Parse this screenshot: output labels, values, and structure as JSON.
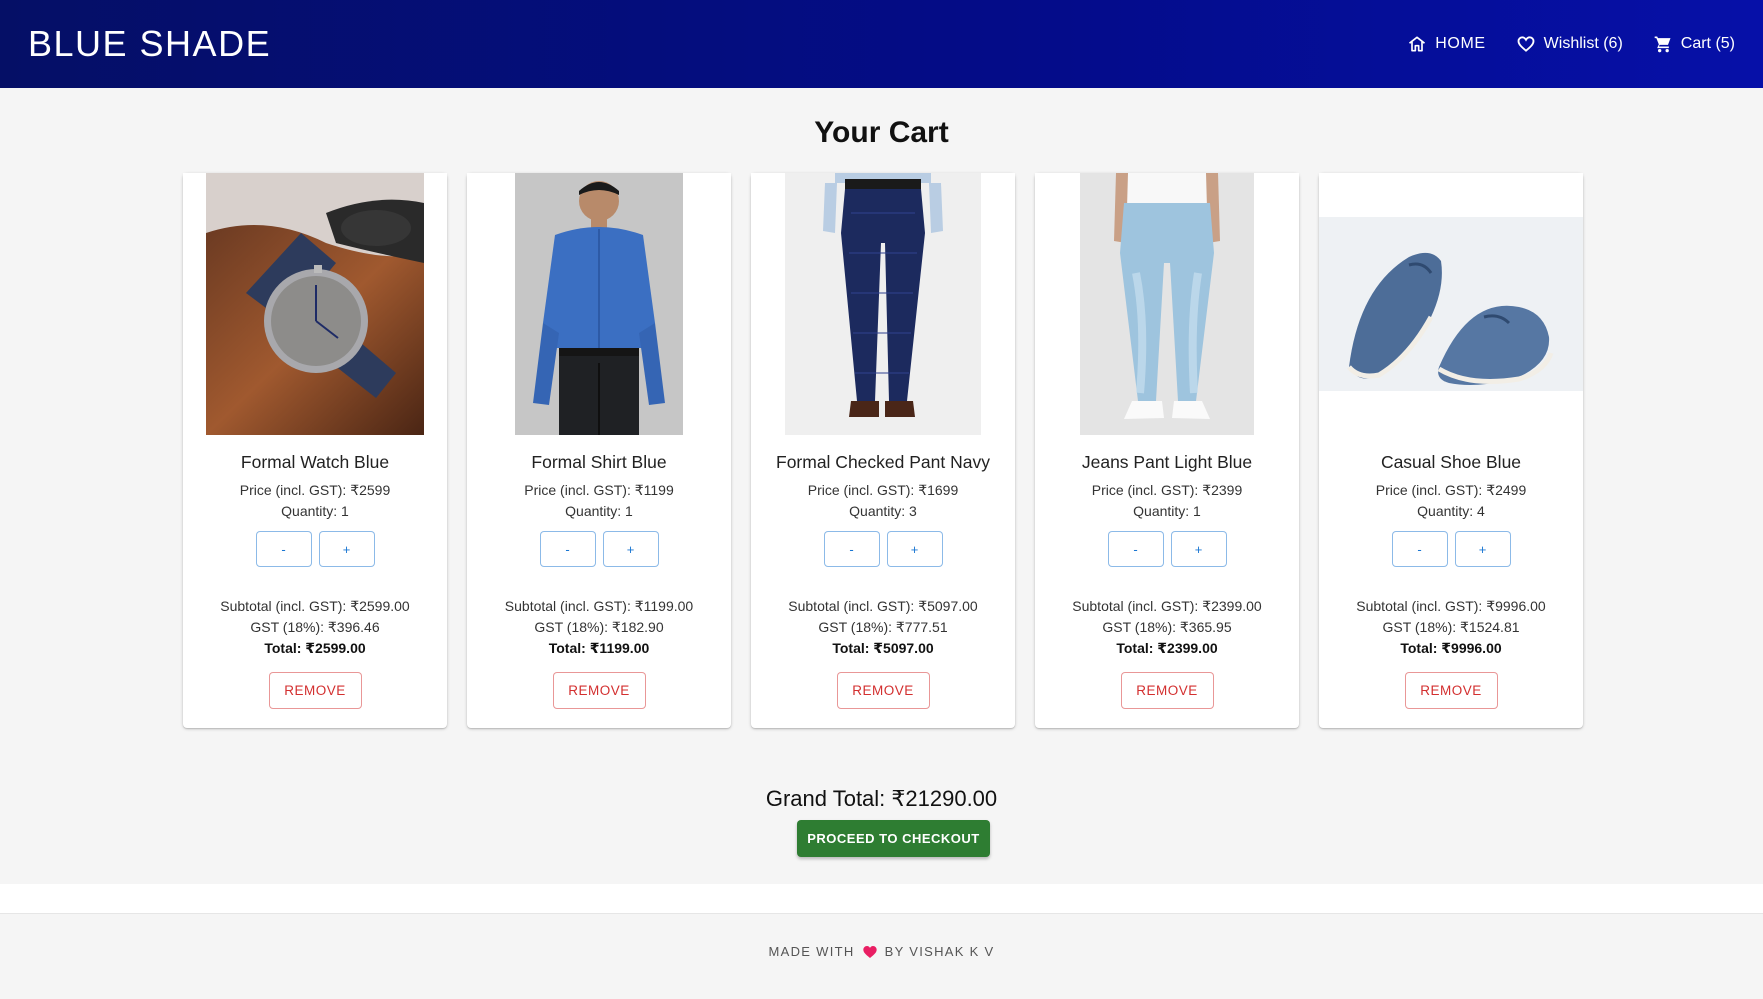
{
  "header": {
    "brand": "BLUE SHADE",
    "nav": [
      {
        "label": "HOME",
        "icon": "home-icon"
      },
      {
        "label": "Wishlist (6)",
        "icon": "heart-icon"
      },
      {
        "label": "Cart (5)",
        "icon": "cart-icon"
      }
    ]
  },
  "page_title": "Your Cart",
  "cart": {
    "items": [
      {
        "name": "Formal Watch Blue",
        "price": "Price (incl. GST): ₹2599",
        "quantity": "Quantity: 1",
        "subtotal": "Subtotal (incl. GST): ₹2599.00",
        "gst": "GST (18%): ₹396.46",
        "total": "Total: ₹2599.00",
        "image": "watch-image"
      },
      {
        "name": "Formal Shirt Blue",
        "price": "Price (incl. GST): ₹1199",
        "quantity": "Quantity: 1",
        "subtotal": "Subtotal (incl. GST): ₹1199.00",
        "gst": "GST (18%): ₹182.90",
        "total": "Total: ₹1199.00",
        "image": "shirt-image"
      },
      {
        "name": "Formal Checked Pant Navy",
        "price": "Price (incl. GST): ₹1699",
        "quantity": "Quantity: 3",
        "subtotal": "Subtotal (incl. GST): ₹5097.00",
        "gst": "GST (18%): ₹777.51",
        "total": "Total: ₹5097.00",
        "image": "pant-image"
      },
      {
        "name": "Jeans Pant Light Blue",
        "price": "Price (incl. GST): ₹2399",
        "quantity": "Quantity: 1",
        "subtotal": "Subtotal (incl. GST): ₹2399.00",
        "gst": "GST (18%): ₹365.95",
        "total": "Total: ₹2399.00",
        "image": "jeans-image"
      },
      {
        "name": "Casual Shoe Blue",
        "price": "Price (incl. GST): ₹2499",
        "quantity": "Quantity: 4",
        "subtotal": "Subtotal (incl. GST): ₹9996.00",
        "gst": "GST (18%): ₹1524.81",
        "total": "Total: ₹9996.00",
        "image": "shoe-image"
      }
    ],
    "decrease_label": "-",
    "increase_label": "+",
    "remove_label": "REMOVE"
  },
  "grand_total": "Grand Total: ₹21290.00",
  "checkout_label": "PROCEED TO CHECKOUT",
  "footer": {
    "prefix": "MADE WITH",
    "suffix": "BY VISHAK K V",
    "heart_color": "#e91e63"
  },
  "colors": {
    "nav_start": "#050f66",
    "nav_end": "#0610a8",
    "checkout_green": "#2e7d32",
    "remove_red": "#d32f2f",
    "stepper_blue": "#1976d2"
  }
}
